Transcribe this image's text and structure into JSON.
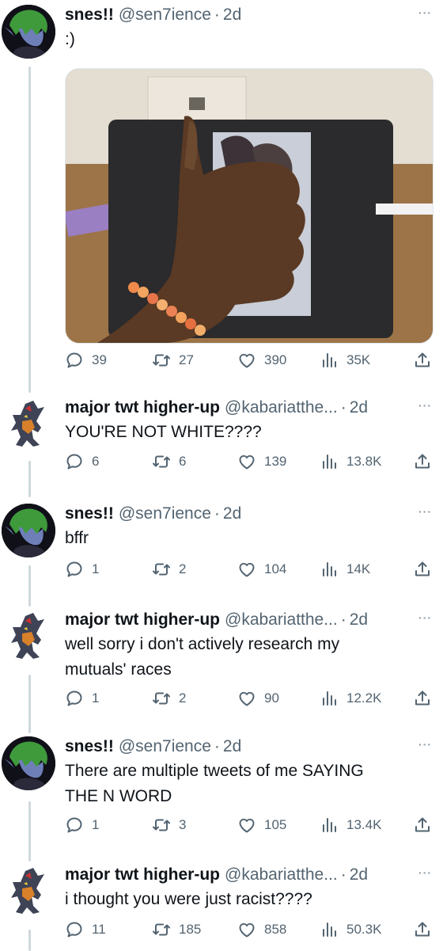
{
  "tweets": [
    {
      "name": "snes!!",
      "handle": "@sen7ience",
      "time": "2d",
      "text": ":)",
      "has_media": true,
      "replies": "39",
      "retweets": "27",
      "likes": "390",
      "views": "35K"
    },
    {
      "name": "major twt higher-up",
      "handle": "@kabariatthe...",
      "time": "2d",
      "text": "YOU'RE NOT WHITE????",
      "replies": "6",
      "retweets": "6",
      "likes": "139",
      "views": "13.8K"
    },
    {
      "name": "snes!!",
      "handle": "@sen7ience",
      "time": "2d",
      "text": "bffr",
      "replies": "1",
      "retweets": "2",
      "likes": "104",
      "views": "14K"
    },
    {
      "name": "major twt higher-up",
      "handle": "@kabariatthe...",
      "time": "2d",
      "text_lines": [
        "well sorry i don't actively research my",
        "mutuals' races"
      ],
      "replies": "1",
      "retweets": "2",
      "likes": "90",
      "views": "12.2K"
    },
    {
      "name": "snes!!",
      "handle": "@sen7ience",
      "time": "2d",
      "text_lines": [
        "There are multiple tweets of me SAYING",
        "THE N WORD"
      ],
      "replies": "1",
      "retweets": "3",
      "likes": "105",
      "views": "13.4K"
    },
    {
      "name": "major twt higher-up",
      "handle": "@kabariatthe...",
      "time": "2d",
      "text": "i thought you were just racist????",
      "replies": "11",
      "retweets": "185",
      "likes": "858",
      "views": "50.3K"
    }
  ],
  "separator": "·",
  "more_glyph": "···",
  "colors": {
    "muted": "#536471",
    "line": "#cfd9de",
    "text": "#0f1419"
  },
  "icons": [
    "reply-icon",
    "retweet-icon",
    "like-icon",
    "views-icon",
    "share-icon",
    "more-icon"
  ]
}
